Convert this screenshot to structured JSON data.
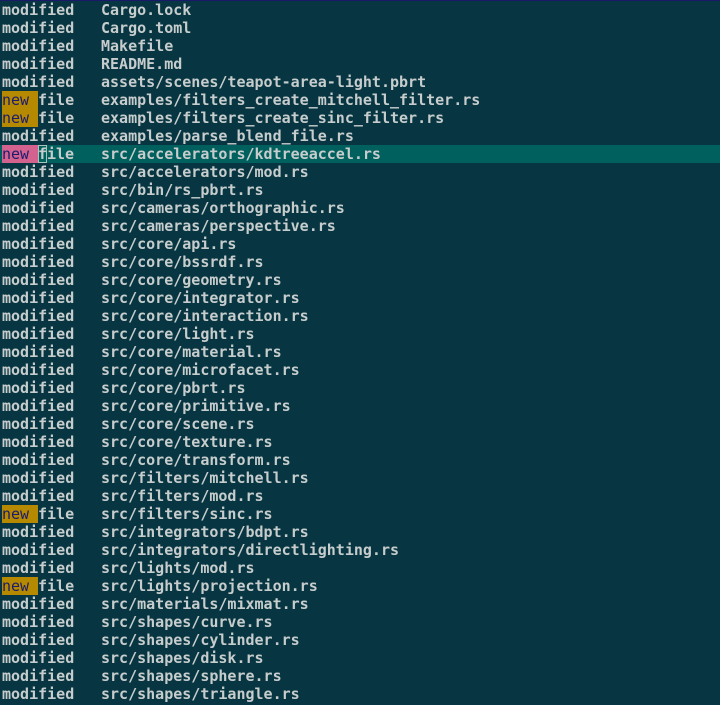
{
  "colors": {
    "background": "#073642",
    "selection": "#00605e",
    "new_badge": "#b58900",
    "new_badge_selected": "#d3628f",
    "text": "#c7cdcd"
  },
  "selected_index": 8,
  "cursor": {
    "row": 8,
    "column": 4
  },
  "rows": [
    {
      "status": "modified",
      "path": "Cargo.lock"
    },
    {
      "status": "modified",
      "path": "Cargo.toml"
    },
    {
      "status": "modified",
      "path": "Makefile"
    },
    {
      "status": "modified",
      "path": "README.md"
    },
    {
      "status": "modified",
      "path": "assets/scenes/teapot-area-light.pbrt"
    },
    {
      "status": "new file",
      "path": "examples/filters_create_mitchell_filter.rs"
    },
    {
      "status": "new file",
      "path": "examples/filters_create_sinc_filter.rs"
    },
    {
      "status": "modified",
      "path": "examples/parse_blend_file.rs"
    },
    {
      "status": "new file",
      "path": "src/accelerators/kdtreeaccel.rs"
    },
    {
      "status": "modified",
      "path": "src/accelerators/mod.rs"
    },
    {
      "status": "modified",
      "path": "src/bin/rs_pbrt.rs"
    },
    {
      "status": "modified",
      "path": "src/cameras/orthographic.rs"
    },
    {
      "status": "modified",
      "path": "src/cameras/perspective.rs"
    },
    {
      "status": "modified",
      "path": "src/core/api.rs"
    },
    {
      "status": "modified",
      "path": "src/core/bssrdf.rs"
    },
    {
      "status": "modified",
      "path": "src/core/geometry.rs"
    },
    {
      "status": "modified",
      "path": "src/core/integrator.rs"
    },
    {
      "status": "modified",
      "path": "src/core/interaction.rs"
    },
    {
      "status": "modified",
      "path": "src/core/light.rs"
    },
    {
      "status": "modified",
      "path": "src/core/material.rs"
    },
    {
      "status": "modified",
      "path": "src/core/microfacet.rs"
    },
    {
      "status": "modified",
      "path": "src/core/pbrt.rs"
    },
    {
      "status": "modified",
      "path": "src/core/primitive.rs"
    },
    {
      "status": "modified",
      "path": "src/core/scene.rs"
    },
    {
      "status": "modified",
      "path": "src/core/texture.rs"
    },
    {
      "status": "modified",
      "path": "src/core/transform.rs"
    },
    {
      "status": "modified",
      "path": "src/filters/mitchell.rs"
    },
    {
      "status": "modified",
      "path": "src/filters/mod.rs"
    },
    {
      "status": "new file",
      "path": "src/filters/sinc.rs"
    },
    {
      "status": "modified",
      "path": "src/integrators/bdpt.rs"
    },
    {
      "status": "modified",
      "path": "src/integrators/directlighting.rs"
    },
    {
      "status": "modified",
      "path": "src/lights/mod.rs"
    },
    {
      "status": "new file",
      "path": "src/lights/projection.rs"
    },
    {
      "status": "modified",
      "path": "src/materials/mixmat.rs"
    },
    {
      "status": "modified",
      "path": "src/shapes/curve.rs"
    },
    {
      "status": "modified",
      "path": "src/shapes/cylinder.rs"
    },
    {
      "status": "modified",
      "path": "src/shapes/disk.rs"
    },
    {
      "status": "modified",
      "path": "src/shapes/sphere.rs"
    },
    {
      "status": "modified",
      "path": "src/shapes/triangle.rs"
    }
  ]
}
